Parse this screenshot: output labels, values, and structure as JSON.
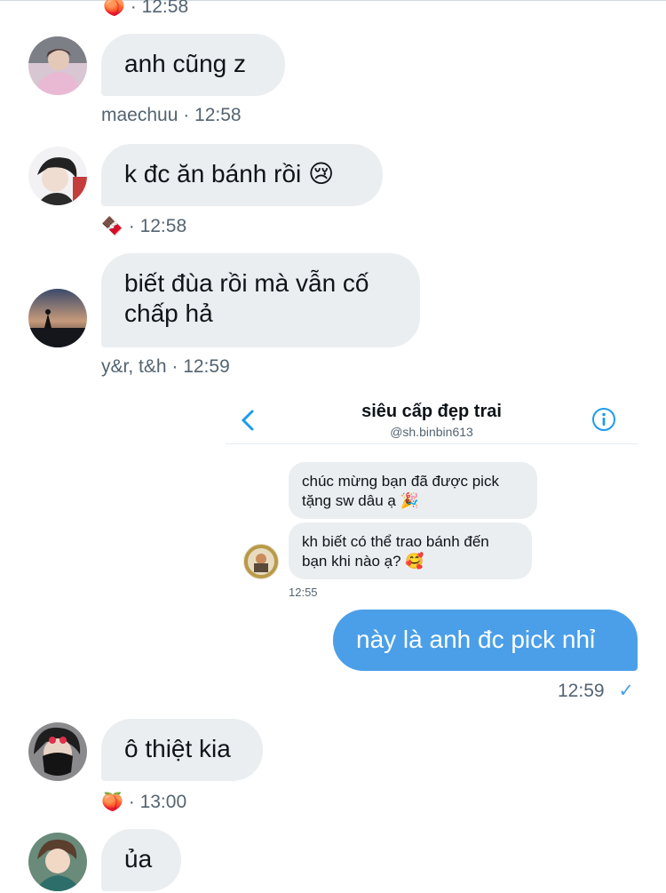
{
  "top_meta": {
    "emoji": "🍑",
    "time": "· 12:58"
  },
  "messages": [
    {
      "text": "anh cũng z",
      "meta": "maechuu · 12:58"
    },
    {
      "text": "k đc ăn bánh rồi 😢",
      "meta_emoji": "🍫",
      "meta": "· 12:58"
    },
    {
      "text_line1": "biết đùa rồi mà vẫn cố",
      "text_line2": "chấp hả",
      "meta": "y&r, t&h · 12:59"
    }
  ],
  "embedded": {
    "title": "siêu cấp đẹp trai",
    "handle": "@sh.binbin613",
    "msg1_line1": "chúc mừng bạn đã được pick",
    "msg1_line2": "tặng sw dâu ạ 🎉",
    "msg2_line1": "kh biết có thể trao bánh đến",
    "msg2_line2": "bạn khi nào ạ? 🥰",
    "time": "12:55"
  },
  "outgoing": {
    "text": "này là anh đc pick nhỉ",
    "time": "12:59",
    "check": "✓"
  },
  "messages2": [
    {
      "text": "ô thiệt kia",
      "meta_emoji": "🍑",
      "meta": "· 13:00"
    },
    {
      "text": "ủa"
    }
  ],
  "colors": {
    "bubble_out": "#4a9fe8",
    "bubble_in": "#ebeef0",
    "link_blue": "#1d9bf0"
  }
}
